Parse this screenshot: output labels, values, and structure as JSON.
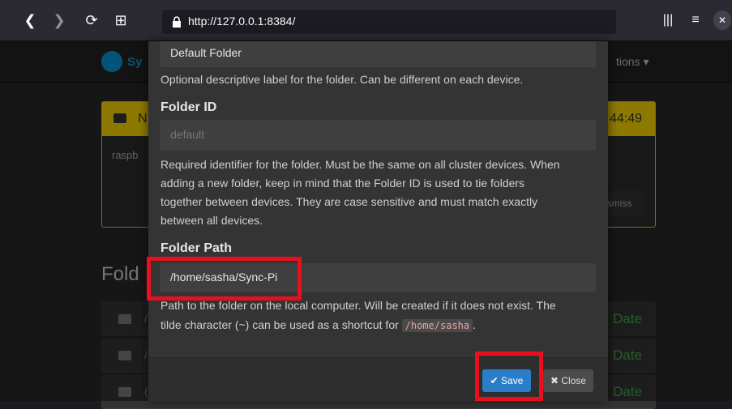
{
  "browser": {
    "url": "http://127.0.0.1:8384/"
  },
  "app": {
    "brand_partial": "Sy",
    "actions_partial": "tions ▾"
  },
  "notice": {
    "header_letter": "N",
    "time": "44:49",
    "body_partial": "raspb",
    "dismiss_partial": "smiss"
  },
  "folders": {
    "heading_partial": "Fold",
    "rows": [
      {
        "letter": "/",
        "date": "Date"
      },
      {
        "letter": "/",
        "date": "Date"
      },
      {
        "letter": "(",
        "date": "Date"
      }
    ]
  },
  "modal": {
    "label_value": "Default Folder",
    "label_help": "Optional descriptive label for the folder. Can be different on each device.",
    "id_label": "Folder ID",
    "id_placeholder": "default",
    "id_help": [
      "Required identifier for the folder. Must be the same on all cluster devices. When",
      "adding a new folder, keep in mind that the Folder ID is used to tie folders",
      "together between devices. They are case sensitive and must match exactly",
      "between all devices."
    ],
    "path_label": "Folder Path",
    "path_value": "/home/sasha/Sync-Pi",
    "path_help_line1": "Path to the folder on the local computer. Will be created if it does not exist. The",
    "path_help_line2_pre": "tilde character (~) can be used as a shortcut for",
    "path_help_code": "/home/sasha",
    "path_help_line2_post": ".",
    "save_label": "Save",
    "close_label": "Close"
  }
}
